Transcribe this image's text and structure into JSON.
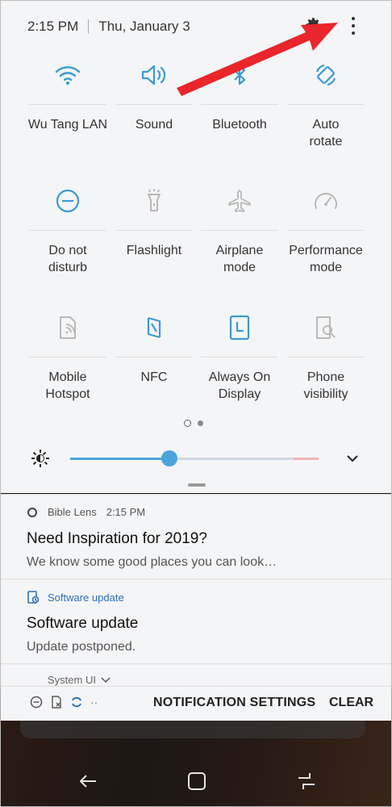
{
  "status": {
    "time": "2:15 PM",
    "date": "Thu, January 3"
  },
  "tiles": [
    {
      "label": "Wu Tang LAN",
      "icon": "wifi-icon",
      "active": true
    },
    {
      "label": "Sound",
      "icon": "sound-icon",
      "active": true
    },
    {
      "label": "Bluetooth",
      "icon": "bluetooth-icon",
      "active": false
    },
    {
      "label": "Auto\nrotate",
      "icon": "auto-rotate-icon",
      "active": true
    },
    {
      "label": "Do not\ndisturb",
      "icon": "do-not-disturb-icon",
      "active": true
    },
    {
      "label": "Flashlight",
      "icon": "flashlight-icon",
      "active": false
    },
    {
      "label": "Airplane\nmode",
      "icon": "airplane-icon",
      "active": false
    },
    {
      "label": "Performance\nmode",
      "icon": "performance-icon",
      "active": false
    },
    {
      "label": "Mobile\nHotspot",
      "icon": "hotspot-icon",
      "active": false
    },
    {
      "label": "NFC",
      "icon": "nfc-icon",
      "active": true
    },
    {
      "label": "Always On\nDisplay",
      "icon": "always-on-display-icon",
      "active": true
    },
    {
      "label": "Phone\nvisibility",
      "icon": "phone-visibility-icon",
      "active": false
    }
  ],
  "brightness": {
    "level": 0.4
  },
  "notifications": [
    {
      "app": "Bible Lens",
      "time": "2:15 PM",
      "title": "Need Inspiration for 2019?",
      "body": "We know some good places you can look…"
    },
    {
      "app": "Software update",
      "time": "",
      "title": "Software update",
      "body": "Update postponed."
    }
  ],
  "peek_notification": {
    "app": "System UI"
  },
  "bottom_bar": {
    "settings_label": "NOTIFICATION SETTINGS",
    "clear_label": "CLEAR",
    "more_label": "··"
  },
  "colors": {
    "accent": "#3a9bd1",
    "inactive": "#b9b9b9",
    "annotation_arrow": "#e8262b"
  }
}
